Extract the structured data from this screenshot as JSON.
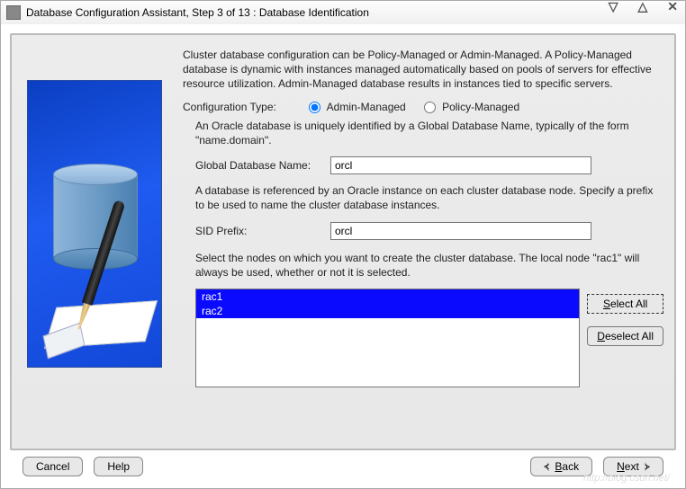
{
  "window": {
    "title": "Database Configuration Assistant, Step 3 of 13 : Database Identification"
  },
  "intro": "Cluster database configuration can be Policy-Managed or Admin-Managed. A Policy-Managed database is dynamic with instances managed automatically based on pools of servers for effective resource utilization. Admin-Managed database results in instances tied to specific servers.",
  "configType": {
    "label": "Configuration Type:",
    "adminLabel": "Admin-Managed",
    "policyLabel": "Policy-Managed",
    "selected": "admin"
  },
  "globalDb": {
    "desc": "An Oracle database is uniquely identified by a Global Database Name, typically of the form \"name.domain\".",
    "label": "Global Database Name:",
    "value": "orcl"
  },
  "sid": {
    "desc": "A database is referenced by an Oracle instance on each cluster database node. Specify a prefix to be used to name the cluster database instances.",
    "label": "SID Prefix:",
    "value": "orcl"
  },
  "nodes": {
    "desc": "Select the nodes on which you want to create the cluster database. The local node \"rac1\" will always be used, whether or not it is selected.",
    "items": [
      "rac1",
      "rac2"
    ],
    "selectAll": "Select All",
    "deselectAll": "Deselect All"
  },
  "buttons": {
    "cancel": "Cancel",
    "help": "Help",
    "back": "Back",
    "next": "Next"
  }
}
